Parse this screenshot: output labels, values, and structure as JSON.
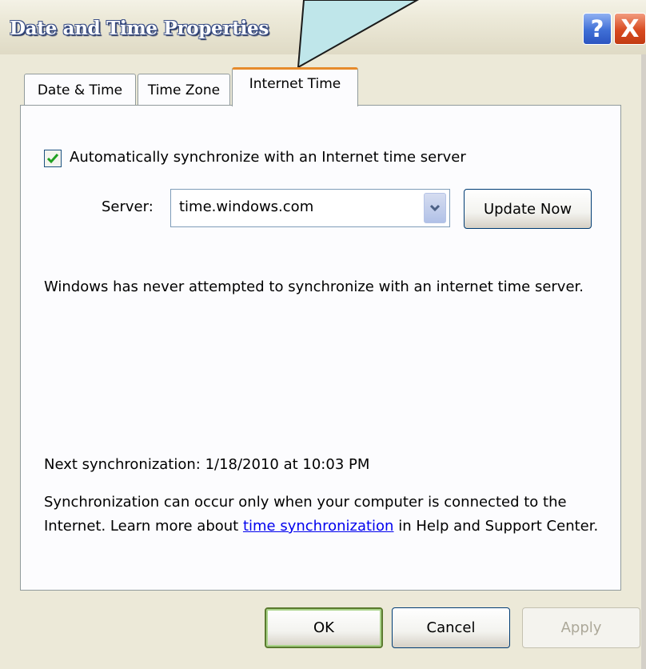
{
  "window": {
    "title": "Date and Time Properties",
    "help_button": "?",
    "close_button": "X"
  },
  "tabs": [
    {
      "label": "Date & Time",
      "active": false
    },
    {
      "label": "Time Zone",
      "active": false
    },
    {
      "label": "Internet Time",
      "active": true
    }
  ],
  "internet_time": {
    "auto_sync_label": "Automatically synchronize with an Internet time server",
    "auto_sync_checked": true,
    "server_label": "Server:",
    "server_value": "time.windows.com",
    "update_now_label": "Update Now",
    "status_message": "Windows has never attempted to synchronize with an internet time server.",
    "next_sync": "Next synchronization: 1/18/2010 at 10:03 PM",
    "info_prefix": "Synchronization can occur only when your computer is connected to the Internet.  Learn more about ",
    "info_link": "time synchronization",
    "info_suffix": " in Help and Support Center."
  },
  "footer": {
    "ok_label": "OK",
    "cancel_label": "Cancel",
    "apply_label": "Apply"
  },
  "colors": {
    "active_tab_accent": "#e68b2c",
    "callout_fill": "#bfe6ea",
    "link": "#0000ee",
    "checkmark": "#21a121"
  }
}
